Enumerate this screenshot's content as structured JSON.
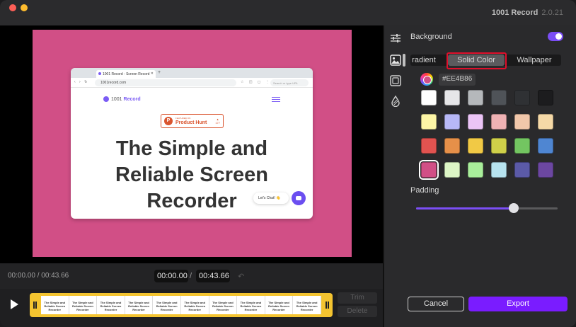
{
  "app": {
    "title": "1001 Record",
    "version": "2.0.21"
  },
  "browser": {
    "tab_title": "1001 Record - Screen Record",
    "url": "1001record.com",
    "search_placeholder": "Search or type URL"
  },
  "website": {
    "logo_prefix": "1001",
    "logo_brand": "Record",
    "badge_small": "FEATURED ON",
    "badge_name": "Product Hunt",
    "badge_count": "177",
    "headline_line1": "The Simple and",
    "headline_line2": "Reliable Screen",
    "headline_line3": "Recorder",
    "chat_label": "Let's Chat! 👋"
  },
  "timeline": {
    "elapsed_total": "00:00.00 / 00:43.66",
    "current_time": "00:00.00",
    "separator": "/",
    "total_time": "00:43.66",
    "frame_text": "The Simple and Reliable Screen Recorder",
    "trim_label": "Trim",
    "delete_label": "Delete"
  },
  "panel": {
    "background_label": "Background",
    "background_enabled": true,
    "tabs": [
      "Gradient",
      "Solid Color",
      "Wallpaper"
    ],
    "tab_visible": [
      "radient",
      "Solid Color",
      "Wallpaper"
    ],
    "active_tab": "Solid Color",
    "hex_value": "#EE4B86",
    "swatches": [
      [
        "#ffffff",
        "#e6e6e8",
        "#b5b8bb",
        "#4f5358",
        "#2f3134",
        "#1c1c1e"
      ],
      [
        "#fdf6a6",
        "#b7b8f7",
        "#ebc4f6",
        "#efb2b4",
        "#f1c7aa",
        "#f5d9a7"
      ],
      [
        "#e15350",
        "#e69049",
        "#f1c945",
        "#cfd049",
        "#73c561",
        "#4f86d2"
      ],
      [
        "#d14f86",
        "#dcf5c5",
        "#a9ee9b",
        "#b7e3ef",
        "#5b5aa7",
        "#6c47a1"
      ]
    ],
    "selected_swatch": "#d14f86",
    "padding_label": "Padding",
    "padding_value": 0.69,
    "cancel_label": "Cancel",
    "export_label": "Export"
  },
  "icons": [
    "adjustments-icon",
    "image-icon",
    "frame-icon",
    "shadow-drop-icon",
    "play-icon",
    "undo-icon"
  ]
}
